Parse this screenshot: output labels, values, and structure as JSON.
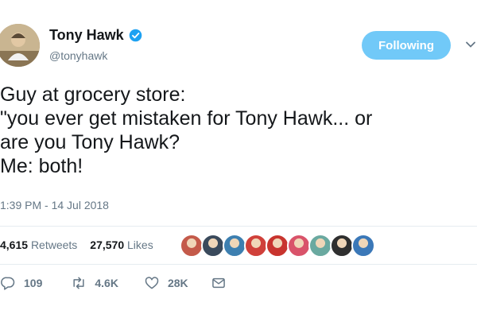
{
  "author": {
    "display_name": "Tony Hawk",
    "handle": "@tonyhawk",
    "verified": true
  },
  "follow_button": {
    "label": "Following"
  },
  "tweet": {
    "lines": [
      "Guy at grocery store:",
      "\"you ever get mistaken for Tony Hawk... or",
      "are you Tony Hawk?",
      "Me: both!"
    ],
    "timestamp": "1:39 PM - 14 Jul 2018"
  },
  "stats": {
    "retweets_count": "4,615",
    "retweets_label": "Retweets",
    "likes_count": "27,570",
    "likes_label": "Likes",
    "liker_avatar_colors": [
      "#c45a4a",
      "#3a4a5c",
      "#3d7fb0",
      "#d0403a",
      "#c8342e",
      "#d9536a",
      "#6aa9a0",
      "#2f2f2f",
      "#3b78b8"
    ]
  },
  "actions": {
    "replies": "109",
    "retweets": "4.6K",
    "likes": "28K"
  },
  "colors": {
    "accent": "#71c9f8",
    "verified": "#1da1f2",
    "secondary_text": "#657786",
    "divider": "#e6ecf0"
  },
  "icons": [
    "verified-badge-icon",
    "chevron-down-icon",
    "reply-icon",
    "retweet-icon",
    "like-icon",
    "direct-message-icon"
  ]
}
